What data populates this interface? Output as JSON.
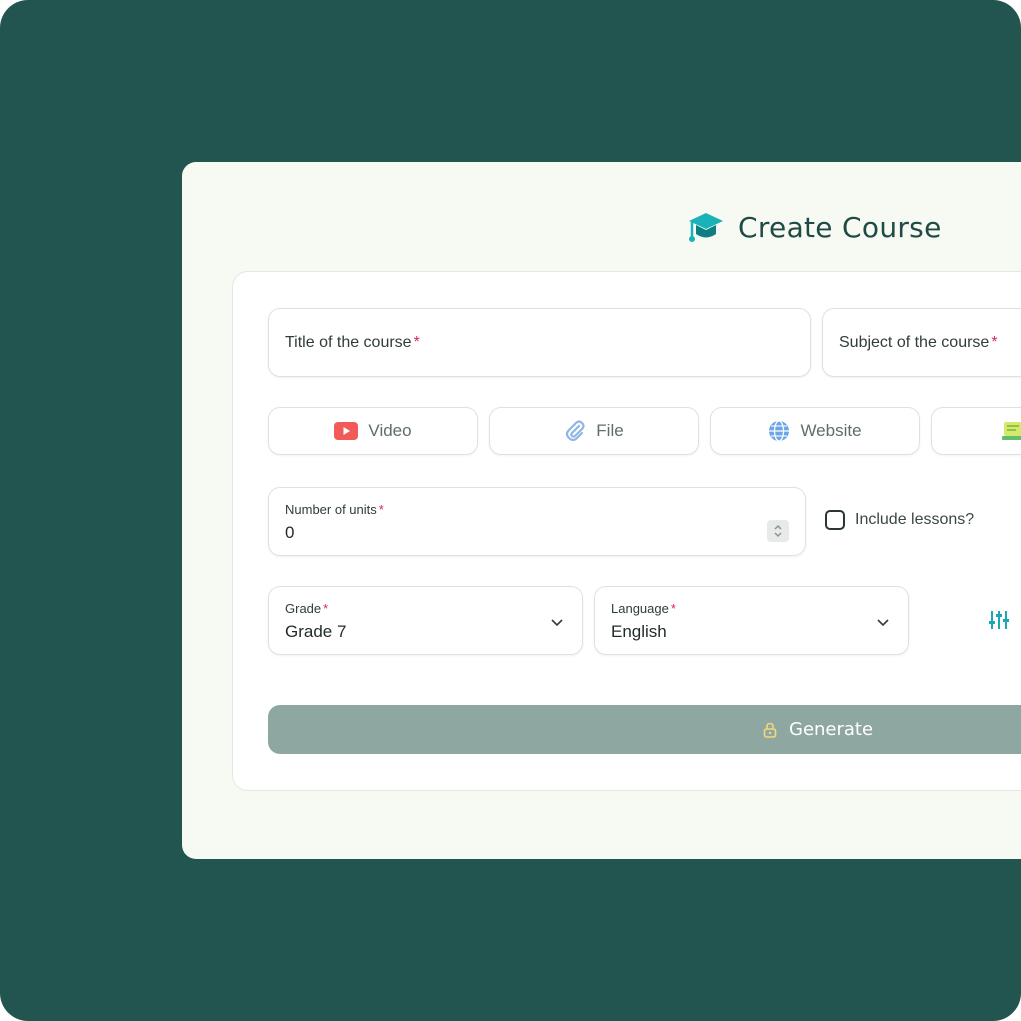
{
  "header": {
    "title": "Create Course",
    "icon": "graduation-cap-icon",
    "accent": "#18b2b8"
  },
  "form": {
    "title_field": {
      "placeholder": "Title of the course",
      "required_mark": "*"
    },
    "subject_field": {
      "placeholder": "Subject of the course",
      "required_mark": "*"
    },
    "sources": [
      {
        "label": "Video",
        "icon": "youtube-icon"
      },
      {
        "label": "File",
        "icon": "paperclip-icon"
      },
      {
        "label": "Website",
        "icon": "globe-icon"
      },
      {
        "label": "",
        "icon": "text-document-icon"
      }
    ],
    "units": {
      "label": "Number of units",
      "required_mark": "*",
      "value": "0"
    },
    "include_lessons": {
      "label": "Include lessons?",
      "checked": false
    },
    "grade": {
      "label": "Grade",
      "required_mark": "*",
      "value": "Grade 7"
    },
    "language": {
      "label": "Language",
      "required_mark": "*",
      "value": "English"
    },
    "options_icon": "sliders-icon",
    "generate": {
      "label": "Generate",
      "icon": "lock-icon"
    }
  },
  "colors": {
    "background": "#22554f",
    "panel": "#f7faf3",
    "required": "#d9285b",
    "generate_button": "#8ea7a1"
  }
}
